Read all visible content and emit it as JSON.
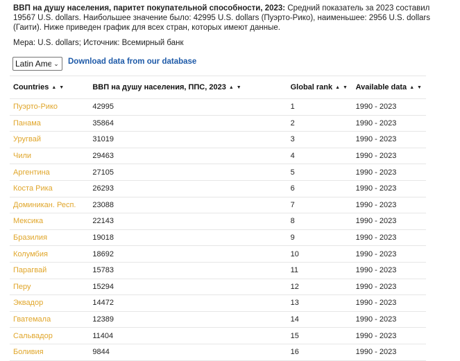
{
  "intro": {
    "title": "ВВП на душу населения, паритет покупательной способности, 2023:",
    "text": "Средний показатель за 2023 составил 19567 U.S. dollars. Наибольшее значение было: 42995 U.S. dollars (Пуэрто-Рико), наименьшее: 2956 U.S. dollars (Гаити). Ниже приведен график для всех стран, которых имеют данные."
  },
  "measure": "Мера: U.S. dollars; Источник: Всемирный банк",
  "region_select": {
    "value": "Latin Ameri",
    "icon": "chevron-down-icon"
  },
  "download_link": "Download data from our database",
  "table": {
    "headers": [
      "Countries",
      "ВВП на душу населения, ППС, 2023",
      "Global rank",
      "Available data"
    ],
    "sort_icon": "▲ ▼",
    "rows": [
      [
        "Пуэрто-Рико",
        "42995",
        "1",
        "1990 - 2023"
      ],
      [
        "Панама",
        "35864",
        "2",
        "1990 - 2023"
      ],
      [
        "Уругвай",
        "31019",
        "3",
        "1990 - 2023"
      ],
      [
        "Чили",
        "29463",
        "4",
        "1990 - 2023"
      ],
      [
        "Аргентина",
        "27105",
        "5",
        "1990 - 2023"
      ],
      [
        "Коста Рика",
        "26293",
        "6",
        "1990 - 2023"
      ],
      [
        "Доминикан. Респ.",
        "23088",
        "7",
        "1990 - 2023"
      ],
      [
        "Мексика",
        "22143",
        "8",
        "1990 - 2023"
      ],
      [
        "Бразилия",
        "19018",
        "9",
        "1990 - 2023"
      ],
      [
        "Колумбия",
        "18692",
        "10",
        "1990 - 2023"
      ],
      [
        "Парагвай",
        "15783",
        "11",
        "1990 - 2023"
      ],
      [
        "Перу",
        "15294",
        "12",
        "1990 - 2023"
      ],
      [
        "Эквадор",
        "14472",
        "13",
        "1990 - 2023"
      ],
      [
        "Гватемала",
        "12389",
        "14",
        "1990 - 2023"
      ],
      [
        "Сальвадор",
        "11404",
        "15",
        "1990 - 2023"
      ],
      [
        "Боливия",
        "9844",
        "16",
        "1990 - 2023"
      ]
    ]
  },
  "colors": {
    "link": "#1e5aa8",
    "country_link": "#e0a62b"
  }
}
